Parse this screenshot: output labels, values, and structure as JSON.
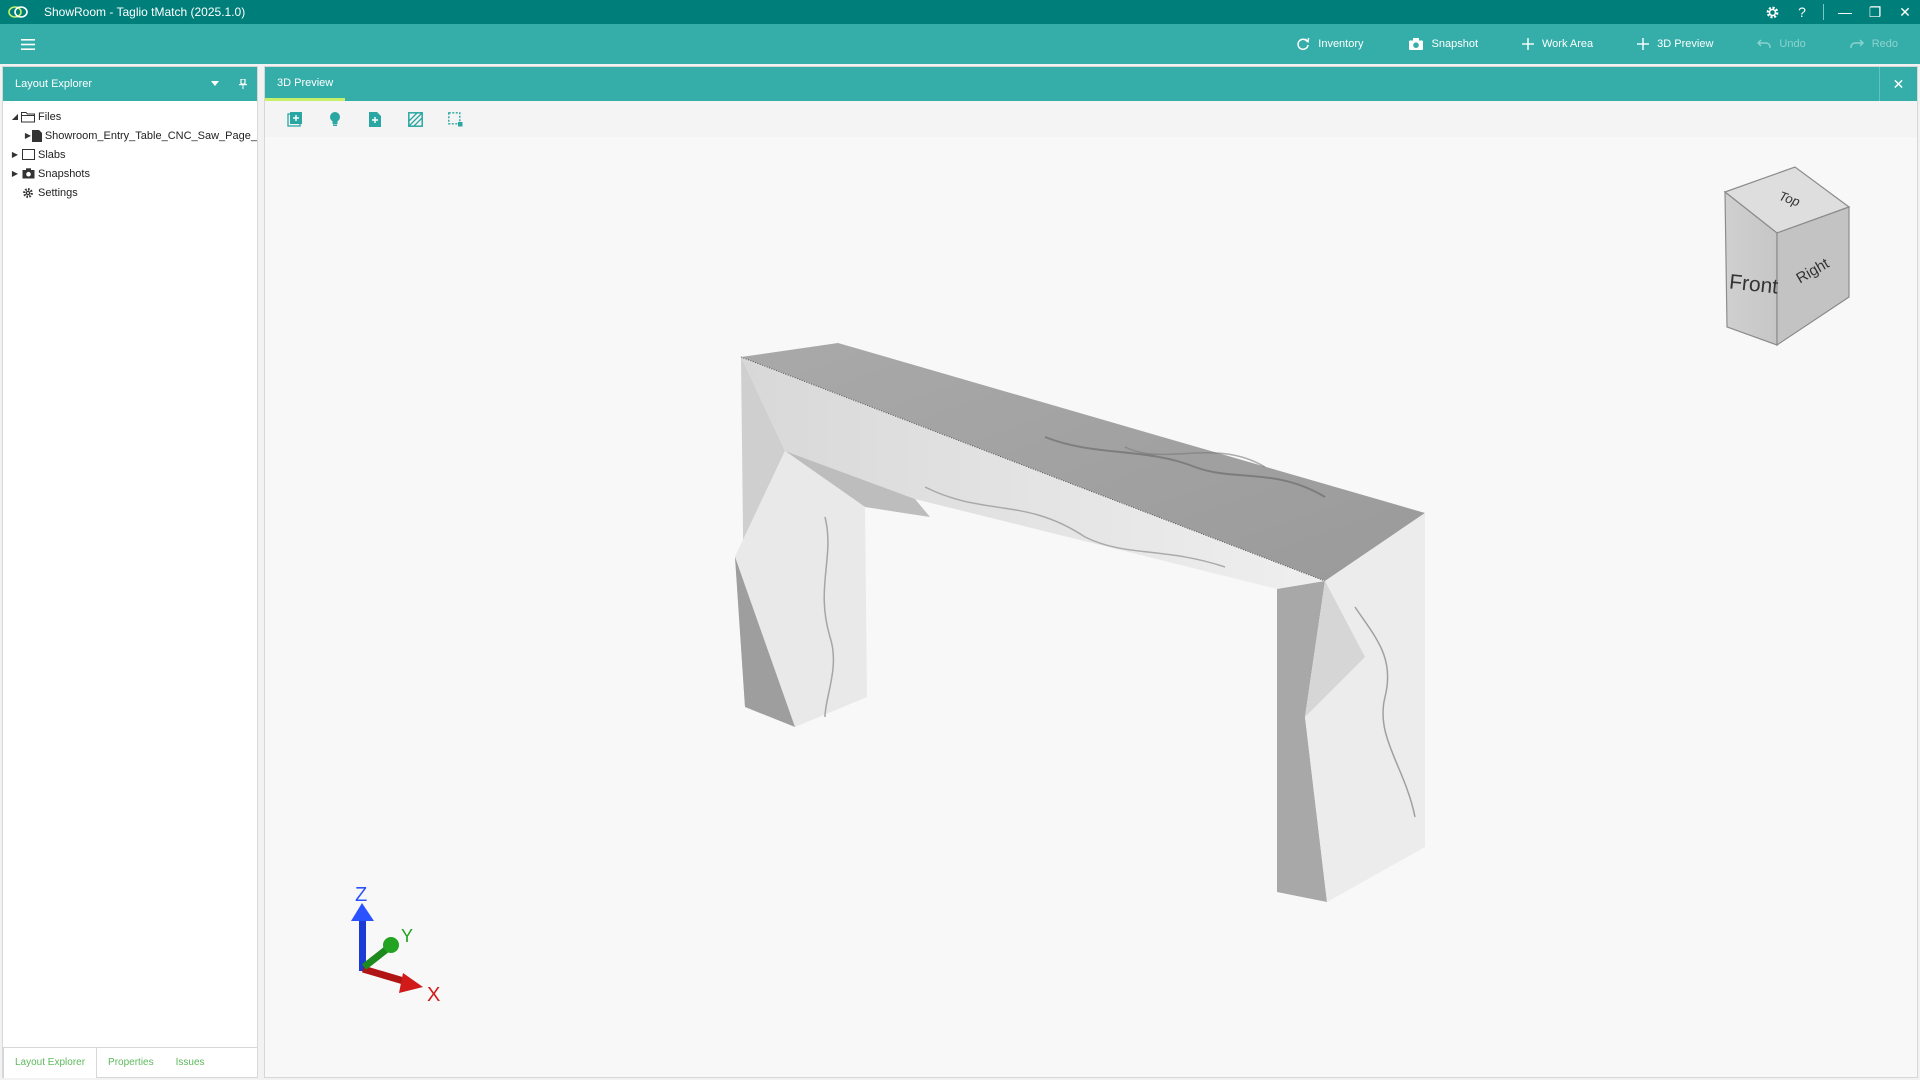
{
  "window": {
    "title": "ShowRoom - Taglio tMatch (2025.1.0)",
    "controls": {
      "settings_icon": "gear-icon",
      "help_label": "?",
      "minimize_label": "—",
      "restore_label": "❐",
      "close_label": "✕"
    }
  },
  "toolbar": {
    "menu_icon": "hamburger-icon",
    "buttons": [
      {
        "label": "Inventory",
        "icon": "refresh-icon",
        "enabled": true
      },
      {
        "label": "Snapshot",
        "icon": "camera-icon",
        "enabled": true
      },
      {
        "label": "Work Area",
        "icon": "plus-icon",
        "enabled": true
      },
      {
        "label": "3D Preview",
        "icon": "plus-icon",
        "enabled": true
      },
      {
        "label": "Undo",
        "icon": "undo-icon",
        "enabled": false
      },
      {
        "label": "Redo",
        "icon": "redo-icon",
        "enabled": false
      }
    ]
  },
  "left_panel": {
    "title": "Layout Explorer",
    "tree": [
      {
        "label": "Files",
        "expanded": true,
        "icon": "folder-icon"
      },
      {
        "label": "Showroom_Entry_Table_CNC_Saw_Page_",
        "icon": "file-icon",
        "level": 1
      },
      {
        "label": "Slabs",
        "expanded": false,
        "icon": "slab-icon"
      },
      {
        "label": "Snapshots",
        "expanded": false,
        "icon": "camera-icon"
      },
      {
        "label": "Settings",
        "icon": "gear-icon"
      }
    ],
    "bottom_tabs": [
      "Layout Explorer",
      "Properties",
      "Issues"
    ],
    "active_bottom_tab": "Layout Explorer"
  },
  "document": {
    "tab_label": "3D Preview",
    "close_label": "✕",
    "tools": [
      "add-view-icon",
      "light-bulb-icon",
      "export-file-icon",
      "texture-icon",
      "selection-box-icon"
    ]
  },
  "viewport": {
    "view_cube": {
      "front": "Front",
      "right": "Right",
      "top": "Top"
    },
    "axes": {
      "x": "X",
      "y": "Y",
      "z": "Z"
    }
  },
  "colors": {
    "title_bar": "#007f7a",
    "command_bar": "#35aea9",
    "accent_green": "#c6f06a",
    "tab_text_green": "#5cb85c"
  }
}
